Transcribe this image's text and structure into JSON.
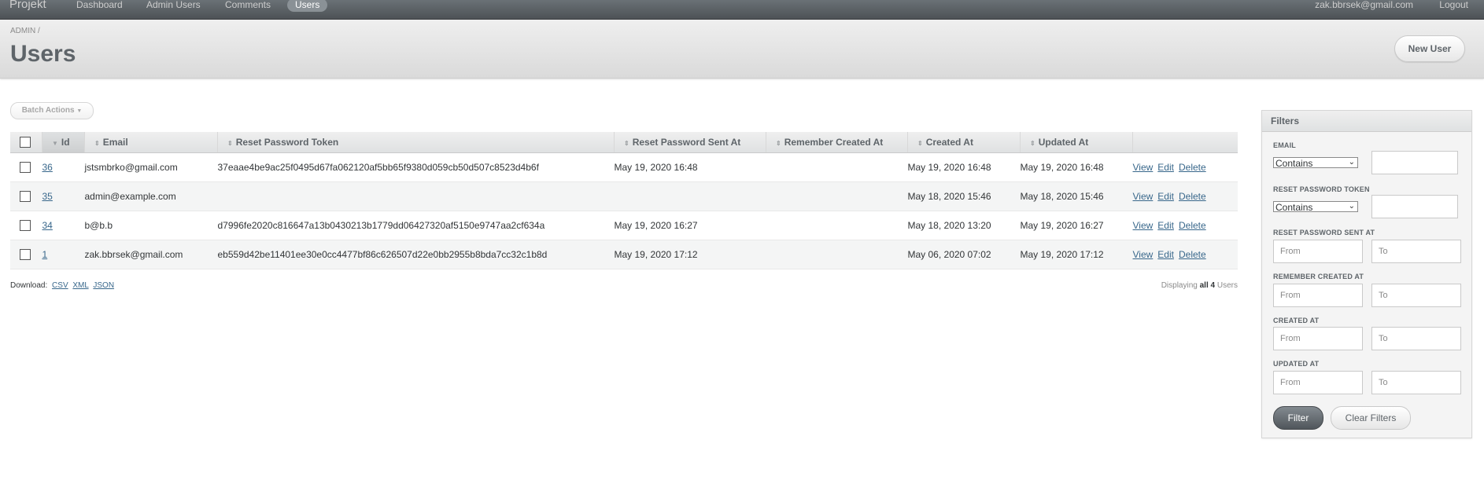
{
  "header": {
    "site_title": "Projekt",
    "nav": [
      "Dashboard",
      "Admin Users",
      "Comments",
      "Users"
    ],
    "current_nav": "Users",
    "user_email": "zak.bbrsek@gmail.com",
    "logout": "Logout"
  },
  "title_bar": {
    "breadcrumb": "ADMIN /",
    "title": "Users",
    "new_button": "New User"
  },
  "batch_actions": "Batch Actions",
  "table": {
    "columns": [
      "Id",
      "Email",
      "Reset Password Token",
      "Reset Password Sent At",
      "Remember Created At",
      "Created At",
      "Updated At"
    ],
    "sorted_column": "Id",
    "rows": [
      {
        "id": "36",
        "email": "jstsmbrko@gmail.com",
        "token": "37eaae4be9ac25f0495d67fa062120af5bb65f9380d059cb50d507c8523d4b6f",
        "sent_at": "May 19, 2020 16:48",
        "remember": "",
        "created": "May 19, 2020 16:48",
        "updated": "May 19, 2020 16:48"
      },
      {
        "id": "35",
        "email": "admin@example.com",
        "token": "",
        "sent_at": "",
        "remember": "",
        "created": "May 18, 2020 15:46",
        "updated": "May 18, 2020 15:46"
      },
      {
        "id": "34",
        "email": "b@b.b",
        "token": "d7996fe2020c816647a13b0430213b1779dd06427320af5150e9747aa2cf634a",
        "sent_at": "May 19, 2020 16:27",
        "remember": "",
        "created": "May 18, 2020 13:20",
        "updated": "May 19, 2020 16:27"
      },
      {
        "id": "1",
        "email": "zak.bbrsek@gmail.com",
        "token": "eb559d42be11401ee30e0cc4477bf86c626507d22e0bb2955b8bda7cc32c1b8d",
        "sent_at": "May 19, 2020 17:12",
        "remember": "",
        "created": "May 06, 2020 07:02",
        "updated": "May 19, 2020 17:12"
      }
    ],
    "row_actions": [
      "View",
      "Edit",
      "Delete"
    ]
  },
  "footer": {
    "download_label": "Download:",
    "download_formats": [
      "CSV",
      "XML",
      "JSON"
    ],
    "pagination": {
      "prefix": "Displaying",
      "count": "all 4",
      "suffix": "Users"
    }
  },
  "filters": {
    "title": "Filters",
    "email_label": "EMAIL",
    "email_operator": "Contains",
    "token_label": "RESET PASSWORD TOKEN",
    "token_operator": "Contains",
    "date_filters": [
      "RESET PASSWORD SENT AT",
      "REMEMBER CREATED AT",
      "CREATED AT",
      "UPDATED AT"
    ],
    "from_placeholder": "From",
    "to_placeholder": "To",
    "filter_button": "Filter",
    "clear_button": "Clear Filters"
  },
  "colors": {
    "header_bg": "#5e6469",
    "link": "#38678b",
    "text": "#323537"
  }
}
